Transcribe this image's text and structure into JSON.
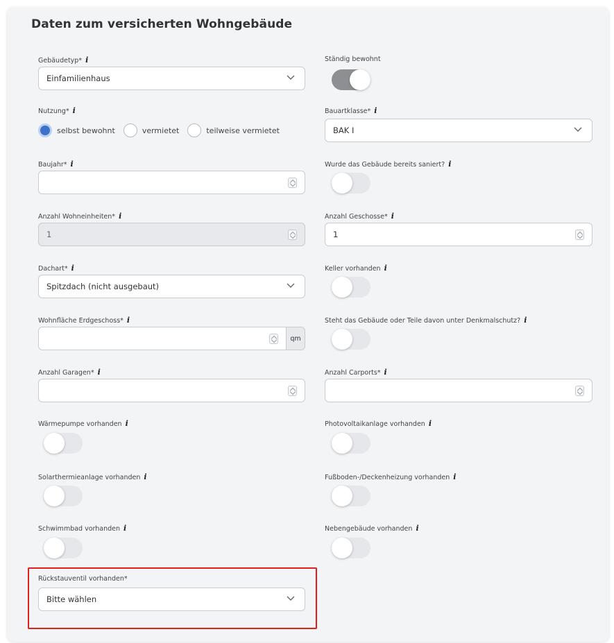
{
  "section": {
    "title": "Daten zum versicherten Wohngebäude"
  },
  "info_glyph": "i",
  "left": {
    "gebaeudetyp": {
      "label": "Gebäudetyp*",
      "value": "Einfamilienhaus"
    },
    "nutzung": {
      "label": "Nutzung*",
      "options": [
        "selbst bewohnt",
        "vermietet",
        "teilweise vermietet"
      ],
      "selected": "selbst bewohnt"
    },
    "baujahr": {
      "label": "Baujahr*",
      "value": ""
    },
    "wohneinheiten": {
      "label": "Anzahl Wohneinheiten*",
      "value": "1"
    },
    "dachart": {
      "label": "Dachart*",
      "value": "Spitzdach (nicht ausgebaut)"
    },
    "wohnflaeche": {
      "label": "Wohnfläche Erdgeschoss*",
      "value": "",
      "unit": "qm"
    },
    "garagen": {
      "label": "Anzahl Garagen*",
      "value": ""
    },
    "waermepumpe": {
      "label": "Wärmepumpe vorhanden",
      "on": false
    },
    "solarthermie": {
      "label": "Solarthermieanlage vorhanden",
      "on": false
    },
    "schwimmbad": {
      "label": "Schwimmbad vorhanden",
      "on": false
    },
    "rueckstauventil": {
      "label": "Rückstauventil vorhanden*",
      "value": "Bitte wählen"
    }
  },
  "right": {
    "staendig_bewohnt": {
      "label": "Ständig bewohnt",
      "on": true
    },
    "bauartklasse": {
      "label": "Bauartklasse*",
      "value": "BAK I"
    },
    "saniert": {
      "label": "Wurde das Gebäude bereits saniert?",
      "on": false
    },
    "geschosse": {
      "label": "Anzahl Geschosse*",
      "value": "1"
    },
    "keller": {
      "label": "Keller vorhanden",
      "on": false
    },
    "denkmalschutz": {
      "label": "Steht das Gebäude oder Teile davon unter Denkmalschutz?",
      "on": false
    },
    "carports": {
      "label": "Anzahl Carports*",
      "value": ""
    },
    "photovoltaik": {
      "label": "Photovoltaikanlage vorhanden",
      "on": false
    },
    "fussbodenheizung": {
      "label": "Fußboden-/Deckenheizung vorhanden",
      "on": false
    },
    "nebengebaeude": {
      "label": "Nebengebäude vorhanden",
      "on": false
    }
  },
  "colors": {
    "highlight": "#e0201a",
    "radio_checked": "#3d72c9",
    "toggle_on": "#8d8f92"
  }
}
